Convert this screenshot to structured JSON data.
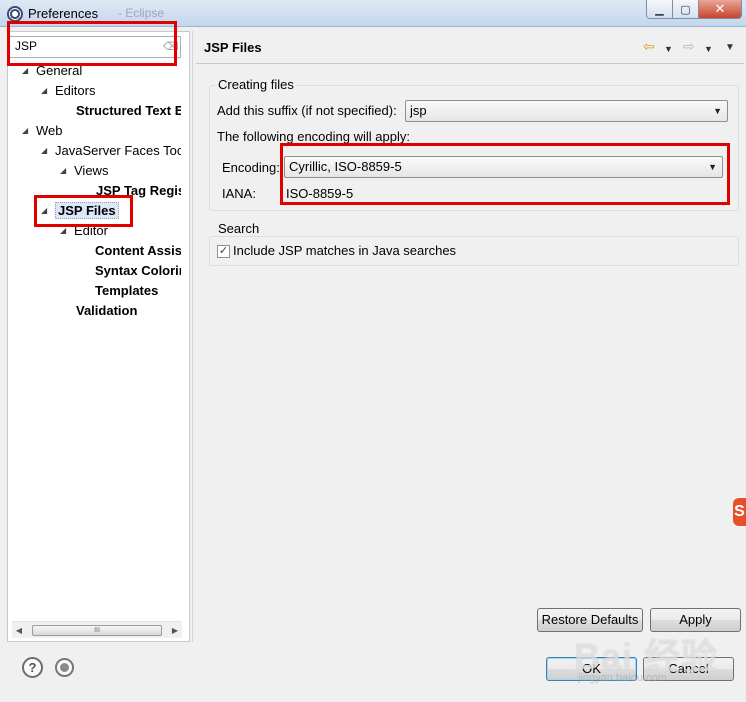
{
  "window": {
    "title": "Preferences",
    "title_ghost": "- Eclipse",
    "minimize_label": "▁",
    "maximize_label": "▢",
    "close_label": "✕"
  },
  "filter": {
    "value": "JSP"
  },
  "tree": [
    {
      "label": "General",
      "arrow": "◢",
      "bold": false
    },
    {
      "label": "Editors",
      "arrow": "◢",
      "bold": false
    },
    {
      "label": "Structured Text E",
      "arrow": "",
      "bold": true
    },
    {
      "label": "Web",
      "arrow": "◢",
      "bold": false
    },
    {
      "label": "JavaServer Faces Toc",
      "arrow": "◢",
      "bold": false
    },
    {
      "label": "Views",
      "arrow": "◢",
      "bold": false
    },
    {
      "label": "JSP Tag Regis",
      "arrow": "",
      "bold": true
    },
    {
      "label": "JSP Files",
      "arrow": "◢",
      "bold": true
    },
    {
      "label": "Editor",
      "arrow": "◢",
      "bold": false
    },
    {
      "label": "Content Assis",
      "arrow": "",
      "bold": true
    },
    {
      "label": "Syntax Colorin",
      "arrow": "",
      "bold": true
    },
    {
      "label": "Templates",
      "arrow": "",
      "bold": true
    },
    {
      "label": "Validation",
      "arrow": "",
      "bold": true
    }
  ],
  "scrollbar": {
    "left": "◀",
    "thumb": "III",
    "right": "▶"
  },
  "page": {
    "title": "JSP Files",
    "nav": {
      "back": "⇦",
      "back_menu": "▼",
      "forward": "⇨",
      "forward_menu": "▼",
      "view_menu": "▼"
    },
    "creating_files": {
      "group_title": "Creating files",
      "suffix_label": "Add this suffix (if not specified):",
      "suffix_value": "jsp",
      "encoding_note": "The following encoding will apply:",
      "encoding_label": "Encoding:",
      "encoding_value": "Cyrillic, ISO-8859-5",
      "iana_label": "IANA:",
      "iana_value": "ISO-8859-5"
    },
    "search": {
      "group_title": "Search",
      "include_label": "Include JSP matches in Java searches",
      "include_checked": true,
      "check_mark": "✓"
    }
  },
  "buttons": {
    "restore_defaults": "Restore Defaults",
    "apply": "Apply",
    "ok": "OK",
    "cancel": "Cancel"
  },
  "footer": {
    "help": "?"
  },
  "watermark": {
    "badge": "S",
    "brand": "Bai 经验",
    "url": "jingyan.baidu.com"
  },
  "colors": {
    "highlight_box": "#e00000",
    "selection": "#dde7f5"
  }
}
